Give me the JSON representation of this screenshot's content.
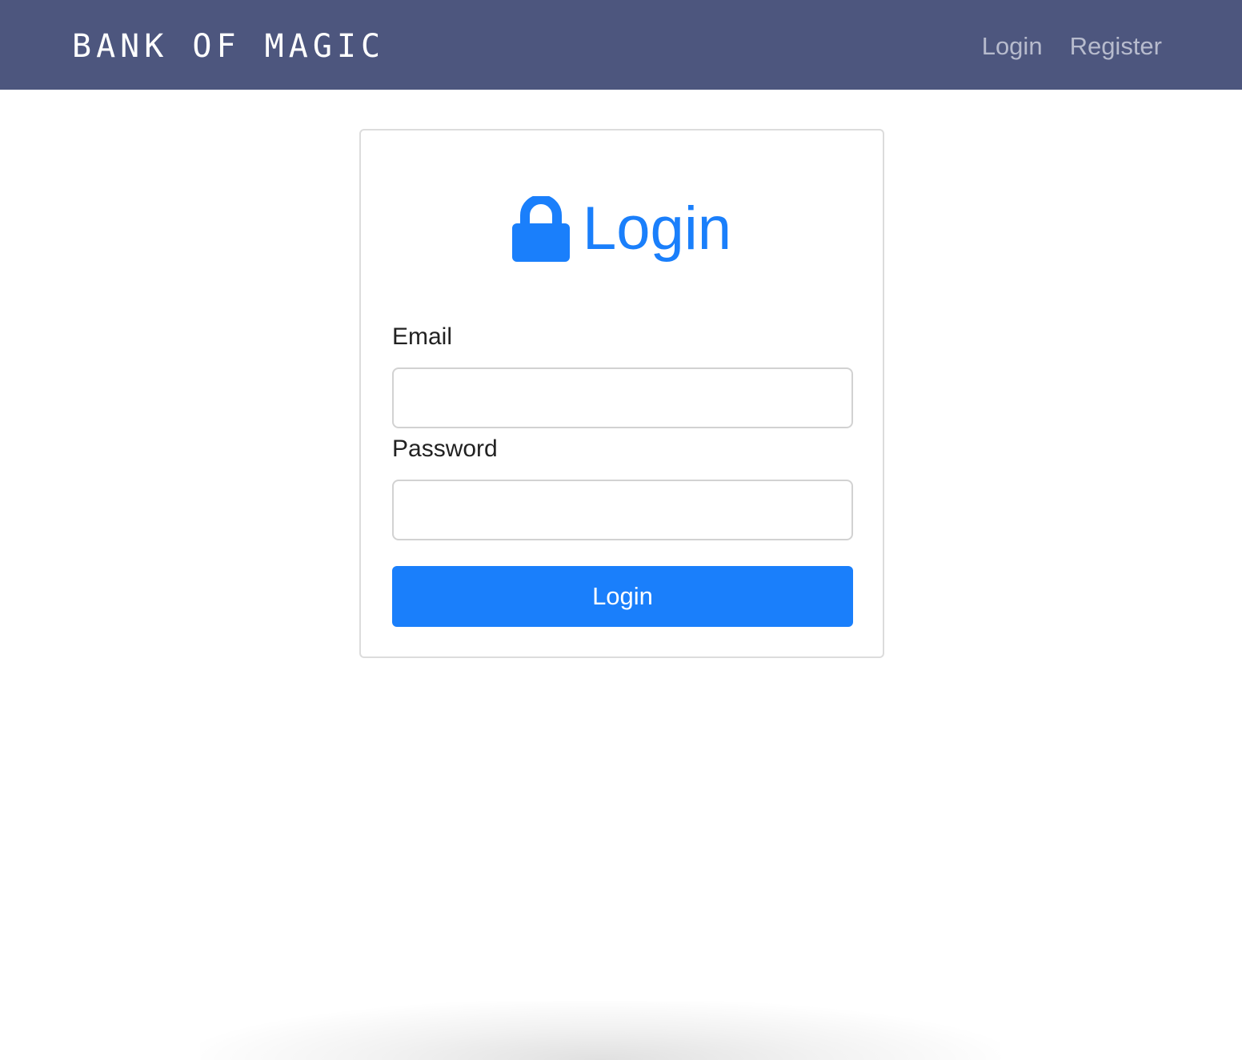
{
  "navbar": {
    "brand": "BANK OF MAGIC",
    "links": [
      {
        "label": "Login"
      },
      {
        "label": "Register"
      }
    ],
    "background_color": "#4d567e"
  },
  "login_card": {
    "title": "Login",
    "title_icon": "lock-icon",
    "accent_color": "#1a7ffb",
    "email": {
      "label": "Email",
      "value": "",
      "placeholder": ""
    },
    "password": {
      "label": "Password",
      "value": "",
      "placeholder": ""
    },
    "submit_label": "Login"
  }
}
